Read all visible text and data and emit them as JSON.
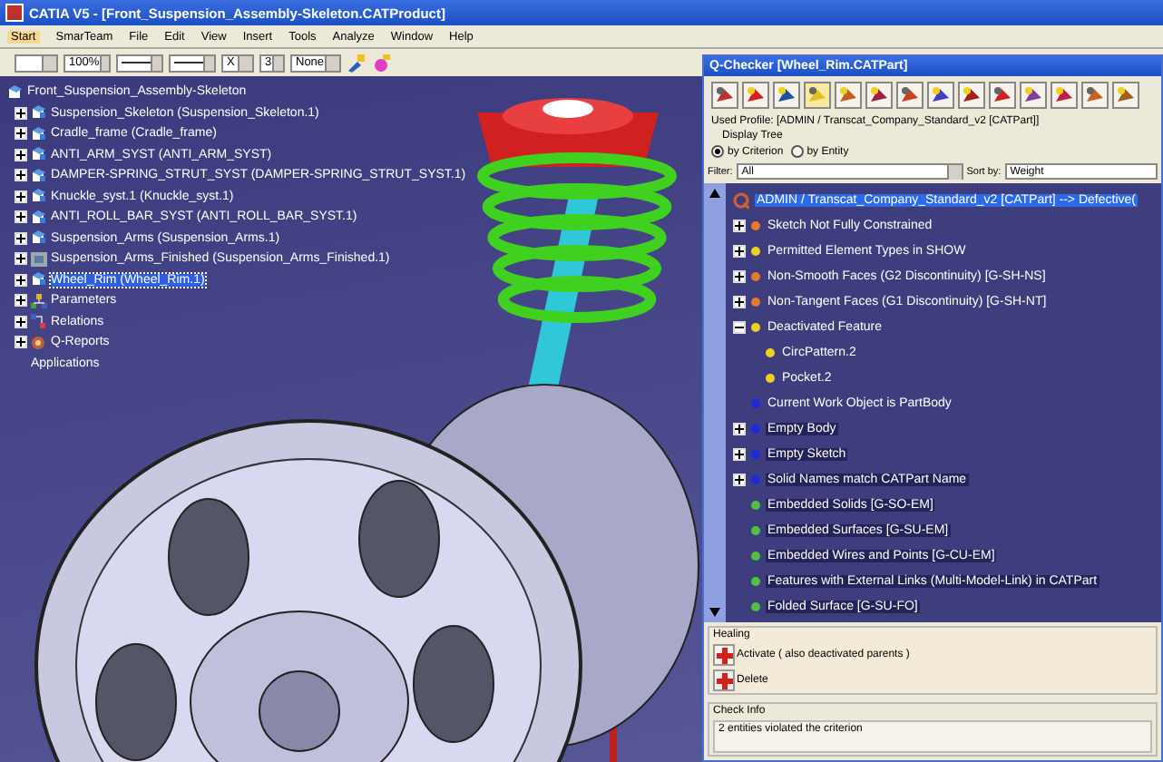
{
  "window": {
    "title": "CATIA V5 - [Front_Suspension_Assembly-Skeleton.CATProduct]"
  },
  "menu": [
    {
      "label": "Start",
      "selected": true
    },
    {
      "label": "SmarTeam",
      "selected": false
    },
    {
      "label": "File",
      "selected": false
    },
    {
      "label": "Edit",
      "selected": false
    },
    {
      "label": "View",
      "selected": false
    },
    {
      "label": "Insert",
      "selected": false
    },
    {
      "label": "Tools",
      "selected": false
    },
    {
      "label": "Analyze",
      "selected": false
    },
    {
      "label": "Window",
      "selected": false
    },
    {
      "label": "Help",
      "selected": false
    }
  ],
  "toolbar": {
    "zoom": "100%",
    "symbol": "X",
    "thickness": "3",
    "layer": "None"
  },
  "spec_tree": {
    "root": "Front_Suspension_Assembly-Skeleton",
    "children": [
      {
        "label": "Suspension_Skeleton (Suspension_Skeleton.1)",
        "kind": "part",
        "selected": false
      },
      {
        "label": "Cradle_frame (Cradle_frame)",
        "kind": "part",
        "selected": false
      },
      {
        "label": "ANTI_ARM_SYST (ANTI_ARM_SYST)",
        "kind": "part",
        "selected": false
      },
      {
        "label": "DAMPER-SPRING_STRUT_SYST (DAMPER-SPRING_STRUT_SYST.1)",
        "kind": "part",
        "selected": false
      },
      {
        "label": "Knuckle_syst.1 (Knuckle_syst.1)",
        "kind": "part",
        "selected": false
      },
      {
        "label": "ANTI_ROLL_BAR_SYST (ANTI_ROLL_BAR_SYST.1)",
        "kind": "part",
        "selected": false
      },
      {
        "label": "Suspension_Arms (Suspension_Arms.1)",
        "kind": "part",
        "selected": false
      },
      {
        "label": "Suspension_Arms_Finished (Suspension_Arms_Finished.1)",
        "kind": "product",
        "selected": false
      },
      {
        "label": "Wheel_Rim (Wheel_Rim.1)",
        "kind": "part",
        "selected": true
      },
      {
        "label": "Parameters",
        "kind": "parameters",
        "selected": false
      },
      {
        "label": "Relations",
        "kind": "relations",
        "selected": false
      },
      {
        "label": "Q-Reports",
        "kind": "reports",
        "selected": false
      },
      {
        "label": "Applications",
        "kind": "applications",
        "selected": false
      }
    ]
  },
  "qchecker": {
    "title": "Q-Checker [Wheel_Rim.CATPart]",
    "used_profile": "Used Profile: [ADMIN / Transcat_Company_Standard_v2 [CATPart]]",
    "display_tree": "Display Tree",
    "radios": [
      {
        "label": "by Criterion",
        "selected": true
      },
      {
        "label": "by Entity",
        "selected": false
      }
    ],
    "filter_label": "Filter:",
    "filter": "All",
    "sort_label": "Sort by:",
    "sort": "Weight",
    "root": {
      "label": "ADMIN / Transcat_Company_Standard_v2 [CATPart] --> Defective(",
      "selected": true
    },
    "criteria": [
      {
        "label": "Sketch Not Fully Constrained",
        "color": "#e8782a",
        "kind": "collapsed",
        "highlighted": false
      },
      {
        "label": "Permitted Element Types in SHOW",
        "color": "#f0d020",
        "kind": "collapsed",
        "highlighted": false
      },
      {
        "label": "Non-Smooth Faces (G2 Discontinuity) [G-SH-NS]",
        "color": "#e8782a",
        "kind": "collapsed",
        "highlighted": false
      },
      {
        "label": "Non-Tangent Faces (G1 Discontinuity) [G-SH-NT]",
        "color": "#e8782a",
        "kind": "collapsed",
        "highlighted": false
      },
      {
        "label": "Deactivated Feature",
        "color": "#f0d020",
        "kind": "expanded",
        "highlighted": false,
        "children": [
          {
            "label": "CircPattern.2",
            "color": "#f0d020"
          },
          {
            "label": "Pocket.2",
            "color": "#f0d020"
          }
        ]
      },
      {
        "label": "Current Work Object is PartBody",
        "color": "#1a2ad8",
        "kind": "leaf",
        "highlighted": false
      },
      {
        "label": "Empty Body",
        "color": "#1a2ad8",
        "kind": "collapsed",
        "highlighted": true
      },
      {
        "label": "Empty Sketch",
        "color": "#1a2ad8",
        "kind": "collapsed",
        "highlighted": true
      },
      {
        "label": "Solid Names match CATPart Name",
        "color": "#1a2ad8",
        "kind": "collapsed",
        "highlighted": true
      },
      {
        "label": "Embedded Solids [G-SO-EM]",
        "color": "#50c040",
        "kind": "leaf",
        "highlighted": true
      },
      {
        "label": "Embedded Surfaces [G-SU-EM]",
        "color": "#50c040",
        "kind": "leaf",
        "highlighted": true
      },
      {
        "label": "Embedded Wires and Points [G-CU-EM]",
        "color": "#50c040",
        "kind": "leaf",
        "highlighted": true
      },
      {
        "label": "Features with External Links (Multi-Model-Link) in CATPart",
        "color": "#50c040",
        "kind": "leaf",
        "highlighted": true
      },
      {
        "label": "Folded Surface [G-SU-FO]",
        "color": "#50c040",
        "kind": "leaf",
        "highlighted": true
      }
    ],
    "healing_title": "Healing",
    "healing": [
      "Activate ( also deactivated parents )",
      "Delete"
    ],
    "check_info_title": "Check Info",
    "check_info": "2 entities violated the criterion"
  }
}
